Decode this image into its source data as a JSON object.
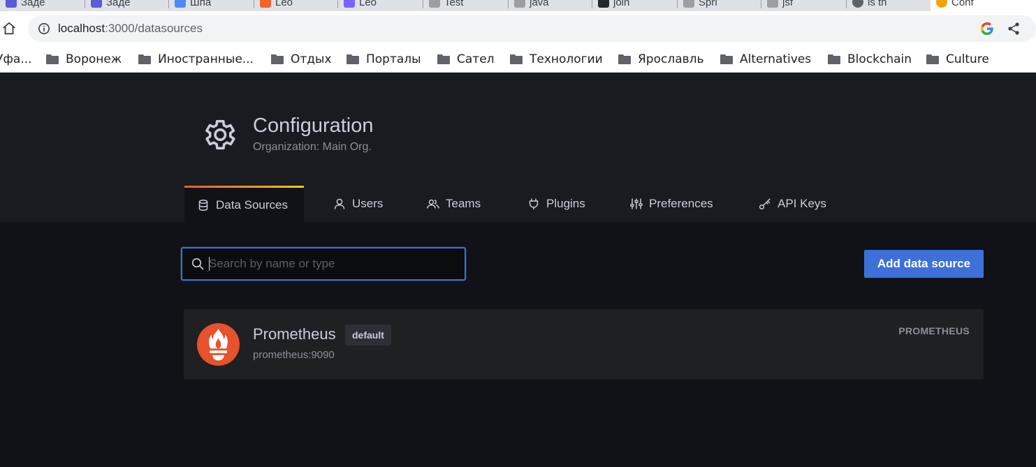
{
  "browser": {
    "tabs": [
      {
        "label": "Заде",
        "color": "#5b5bd6"
      },
      {
        "label": "Заде",
        "color": "#5b5bd6"
      },
      {
        "label": "Шпа",
        "color": "#4c8bf5"
      },
      {
        "label": "Leo",
        "color": "#f16529"
      },
      {
        "label": "Leo",
        "color": "#7b61ff"
      },
      {
        "label": "Test",
        "color": "#9e9e9e"
      },
      {
        "label": "java",
        "color": "#9e9e9e"
      },
      {
        "label": "join",
        "color": "#24292e"
      },
      {
        "label": "Spri",
        "color": "#9e9e9e"
      },
      {
        "label": "jsf",
        "color": "#9e9e9e"
      },
      {
        "label": "is th",
        "color": "#5f6368"
      },
      {
        "label": "Conf",
        "color": "#f0a30a"
      }
    ],
    "url_host": "localhost",
    "url_path": ":3000/datasources",
    "bookmarks": [
      "Уфа...",
      "Воронеж",
      "Иностранные...",
      "Отдых",
      "Порталы",
      "Сател",
      "Технологии",
      "Ярославль",
      "Alternatives",
      "Blockchain",
      "Culture"
    ]
  },
  "header": {
    "title": "Configuration",
    "subtitle": "Organization: Main Org."
  },
  "tabs": [
    {
      "label": "Data Sources",
      "icon": "database-icon",
      "active": true
    },
    {
      "label": "Users",
      "icon": "user-icon",
      "active": false
    },
    {
      "label": "Teams",
      "icon": "users-icon",
      "active": false
    },
    {
      "label": "Plugins",
      "icon": "plug-icon",
      "active": false
    },
    {
      "label": "Preferences",
      "icon": "sliders-icon",
      "active": false
    },
    {
      "label": "API Keys",
      "icon": "key-icon",
      "active": false
    }
  ],
  "search": {
    "placeholder": "Search by name or type",
    "value": ""
  },
  "actions": {
    "add_label": "Add data source"
  },
  "datasources": [
    {
      "name": "Prometheus",
      "badge": "default",
      "url": "prometheus:9090",
      "type": "PROMETHEUS",
      "logo": "prometheus-logo-icon"
    }
  ],
  "colors": {
    "accent": "#3d71d9",
    "tab_gradient_start": "#f05a28",
    "tab_gradient_end": "#fbca0a",
    "prometheus": "#e6522c"
  }
}
